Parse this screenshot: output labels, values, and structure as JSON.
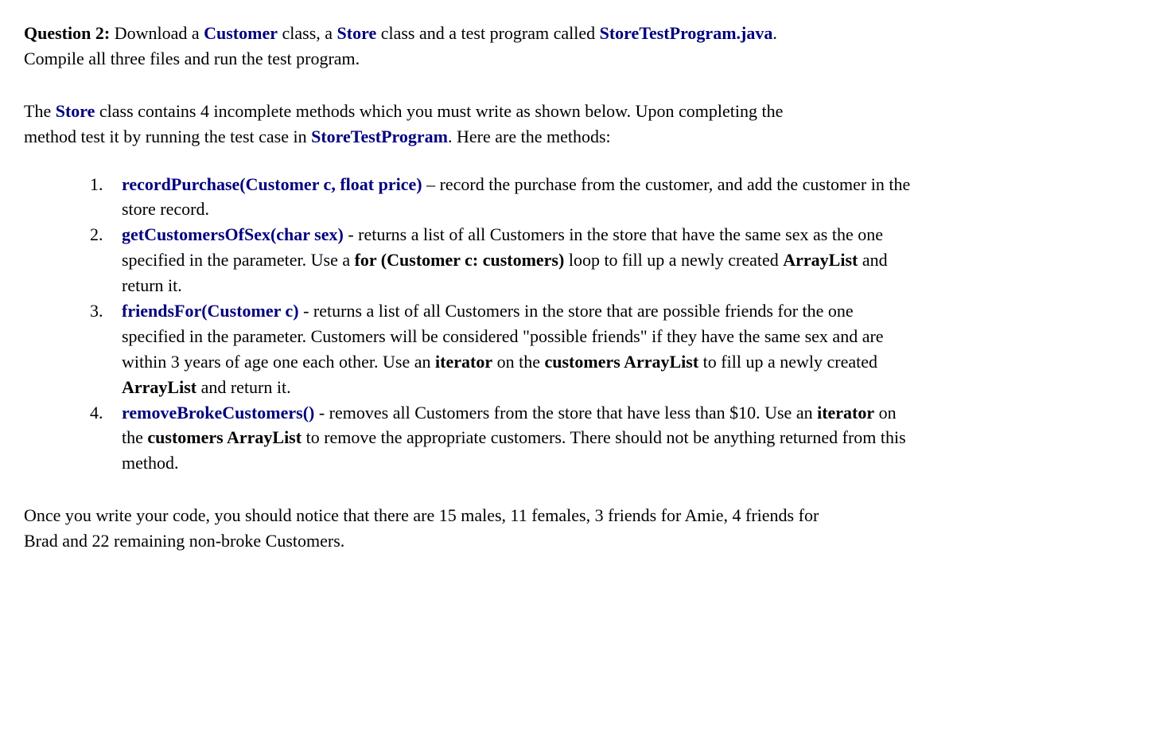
{
  "q_label": "Question 2:",
  "intro_seg1": " Download a ",
  "intro_link1": "Customer",
  "intro_seg2": " class, a ",
  "intro_link2": "Store",
  "intro_seg3": " class and a test program called ",
  "intro_link3": "StoreTestProgram.java",
  "intro_seg4": ".   Compile all three files and run the test program.",
  "p2_seg1": "The ",
  "p2_link1": "Store",
  "p2_seg2": " class contains 4 incomplete methods which you must write as shown below.   Upon completing the method test it by running the test case in ",
  "p2_link2": "StoreTestProgram",
  "p2_seg3": ".   Here are the methods:",
  "m1_sig": "recordPurchase(Customer c, float price)",
  "m1_seg1": " – record the purchase from the customer, and add the customer in the store record.",
  "m2_sig": "getCustomersOfSex(char sex)",
  "m2_seg1": " - returns a list of all Customers in the store that have the same sex as the one specified in the parameter.   Use a ",
  "m2_bold1": "for (Customer c: customers)",
  "m2_seg2": " loop to fill up a newly created ",
  "m2_bold2": "ArrayList",
  "m2_seg3": " and return it.",
  "m3_sig": "friendsFor(Customer c)",
  "m3_seg1": " - returns a list of all Customers in the store that are possible friends for the one specified in the parameter.   Customers will be considered \"possible friends\" if they have the same sex and are within 3 years of age one each other.   Use an ",
  "m3_bold1": "iterator",
  "m3_seg2": " on the ",
  "m3_bold2": "customers ArrayList",
  "m3_seg3": " to fill up a newly created ",
  "m3_bold3": "ArrayList",
  "m3_seg4": " and return it.",
  "m4_sig": "removeBrokeCustomers()",
  "m4_seg1": " - removes all Customers from the store that have less than $10.   Use an ",
  "m4_bold1": "iterator",
  "m4_seg2": " on the ",
  "m4_bold2": "customers ArrayList",
  "m4_seg3": " to remove the appropriate customers.   There should not be anything returned from this method.",
  "closing": "Once you write your code, you should notice that there are 15 males, 11 females, 3 friends for Amie, 4 friends for Brad and 22 remaining non-broke Customers."
}
